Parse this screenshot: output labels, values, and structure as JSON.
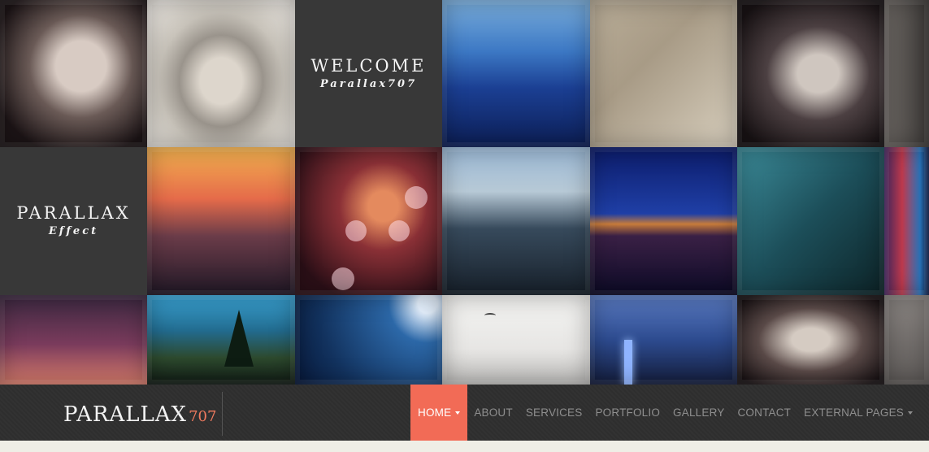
{
  "tiles": {
    "welcome": {
      "title": "WELCOME",
      "subtitle": "Parallax707"
    },
    "parallax": {
      "title": "PARALLAX",
      "subtitle": "Effect"
    }
  },
  "nav": {
    "brand_main": "PARALLAX",
    "brand_sub": "707",
    "items": [
      {
        "label": "HOME",
        "active": true,
        "dropdown": true
      },
      {
        "label": "ABOUT"
      },
      {
        "label": "SERVICES"
      },
      {
        "label": "PORTFOLIO"
      },
      {
        "label": "GALLERY"
      },
      {
        "label": "CONTACT"
      },
      {
        "label": "EXTERNAL PAGES",
        "dropdown": true
      }
    ],
    "accent_color": "#f26b56"
  }
}
